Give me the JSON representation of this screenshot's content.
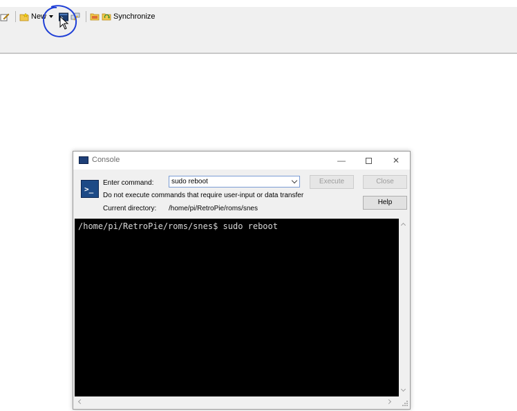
{
  "toolbar": {
    "new_label": "New",
    "synchronize_label": "Synchronize"
  },
  "console": {
    "title": "Console",
    "enter_command_label": "Enter command:",
    "command_value": "sudo reboot",
    "warning_text": "Do not execute commands that require user-input or data transfer",
    "current_directory_label": "Current directory:",
    "current_directory_value": "/home/pi/RetroPie/roms/snes",
    "execute_label": "Execute",
    "close_label": "Close",
    "help_label": "Help",
    "terminal_output": "/home/pi/RetroPie/roms/snes$ sudo reboot"
  },
  "colors": {
    "annotation": "#1f3fd6",
    "terminal_bg": "#000000",
    "terminal_fg": "#d8d8d8"
  }
}
